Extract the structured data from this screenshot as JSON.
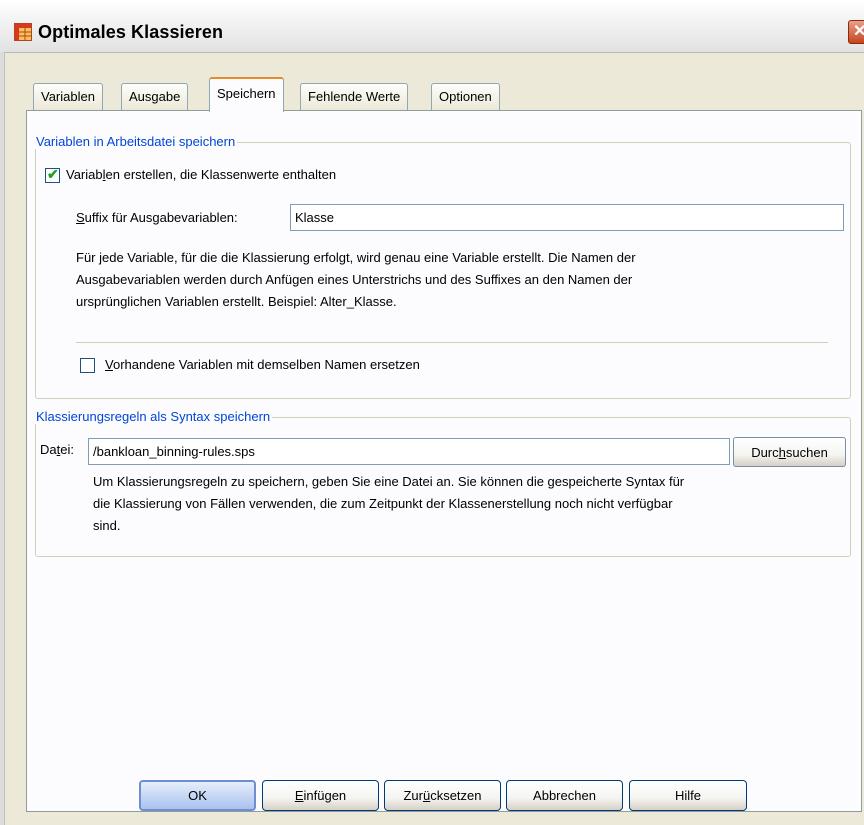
{
  "window": {
    "title": "Optimales Klassieren",
    "close_glyph": "✕"
  },
  "tabs": [
    {
      "label": "Variablen"
    },
    {
      "label": "Ausgabe"
    },
    {
      "label": "Speichern"
    },
    {
      "label": "Fehlende Werte"
    },
    {
      "label": "Optionen"
    }
  ],
  "group1": {
    "title": "Variablen in Arbeitsdatei speichern",
    "create_checkbox": {
      "label_before": "Variab",
      "label_underlined": "l",
      "label_after": "en erstellen, die Klassenwerte enthalten",
      "checked": true
    },
    "suffix": {
      "label_underlined": "S",
      "label_rest": "uffix für Ausgabevariablen:",
      "value": "Klasse"
    },
    "help_lines": [
      "Für jede Variable, für die die Klassierung erfolgt, wird genau eine Variable erstellt. Die Namen der",
      "Ausgabevariablen werden durch Anfügen eines Unterstrichs und des Suffixes an den Namen der",
      "ursprünglichen Variablen erstellt. Beispiel: Alter_Klasse."
    ],
    "replace_checkbox": {
      "label_underlined": "V",
      "label_rest": "orhandene Variablen mit demselben Namen ersetzen",
      "checked": false
    }
  },
  "group2": {
    "title": "Klassierungsregeln als Syntax speichern",
    "file": {
      "label_before": "Da",
      "label_underlined": "t",
      "label_after": "ei:",
      "value": "/bankloan_binning-rules.sps"
    },
    "browse_button": {
      "label_before": "Durc",
      "label_underlined": "h",
      "label_after": "suchen"
    },
    "help_lines": [
      "Um Klassierungsregeln zu speichern, geben Sie eine Datei an. Sie können die gespeicherte Syntax für",
      "die Klassierung von Fällen verwenden, die zum Zeitpunkt der Klassenerstellung noch nicht verfügbar",
      "sind."
    ]
  },
  "buttons": {
    "ok": "OK",
    "paste": {
      "underlined": "E",
      "rest": "infügen"
    },
    "reset": {
      "before": "Zur",
      "underlined": "ü",
      "after": "cksetzen"
    },
    "cancel": "Abbrechen",
    "help": "Hilfe"
  },
  "colors": {
    "group_title": "#0046d5",
    "active_tab_accent": "#e68b2c",
    "dialog_bg": "#ece9d8"
  }
}
